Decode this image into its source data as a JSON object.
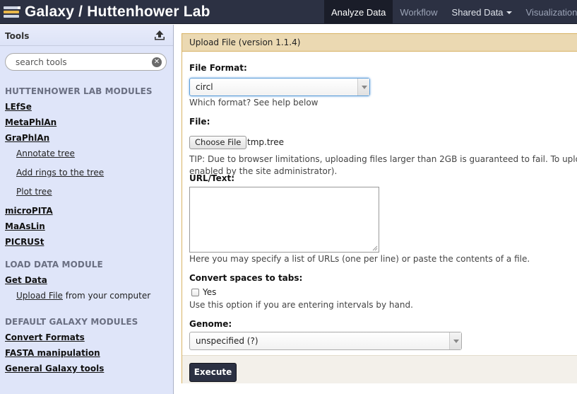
{
  "masthead": {
    "brand": "Galaxy / Huttenhower Lab",
    "nav": [
      {
        "label": "Analyze Data"
      },
      {
        "label": "Workflow"
      },
      {
        "label": "Shared Data"
      },
      {
        "label": "Visualization"
      }
    ]
  },
  "tool_panel": {
    "title": "Tools",
    "search_placeholder": "search tools",
    "sections": {
      "huttenhower": "HUTTENHOWER LAB MODULES",
      "load_data": "LOAD DATA MODULE",
      "default": "DEFAULT GALAXY MODULES"
    },
    "huttenhower_tools": [
      "LEfSe",
      "MetaPhlAn",
      "GraPhlAn"
    ],
    "graphlan_subtools": [
      "Annotate tree",
      "Add rings to the tree",
      "Plot tree"
    ],
    "more_tools": [
      "microPITA",
      "MaAsLin",
      "PICRUSt"
    ],
    "get_data": "Get Data",
    "upload_file": {
      "link": "Upload File",
      "suffix": " from your computer"
    },
    "default_tools": [
      "Convert Formats",
      "FASTA manipulation",
      "General Galaxy tools"
    ]
  },
  "form": {
    "title": "Upload File (version 1.1.4)",
    "file_format": {
      "label": "File Format:",
      "value": "circl",
      "help": "Which format? See help below"
    },
    "file": {
      "label": "File:",
      "button": "Choose File",
      "filename": "tmp.tree",
      "tip_line1": "TIP: Due to browser limitations, uploading files larger than 2GB is guaranteed to fail. To uploa",
      "tip_line2": "enabled by the site administrator)."
    },
    "url_text": {
      "label": "URL/Text:",
      "value": "",
      "help": "Here you may specify a list of URLs (one per line) or paste the contents of a file."
    },
    "convert_spaces": {
      "label": "Convert spaces to tabs:",
      "option": "Yes",
      "checked": false,
      "help": "Use this option if you are entering intervals by hand."
    },
    "genome": {
      "label": "Genome:",
      "value": "unspecified (?)"
    },
    "execute": "Execute"
  },
  "colors": {
    "masthead": "#2c3143",
    "tool_panel": "#dfe5f9",
    "form_header": "#ebd9b2",
    "form_border": "#d8b365"
  }
}
